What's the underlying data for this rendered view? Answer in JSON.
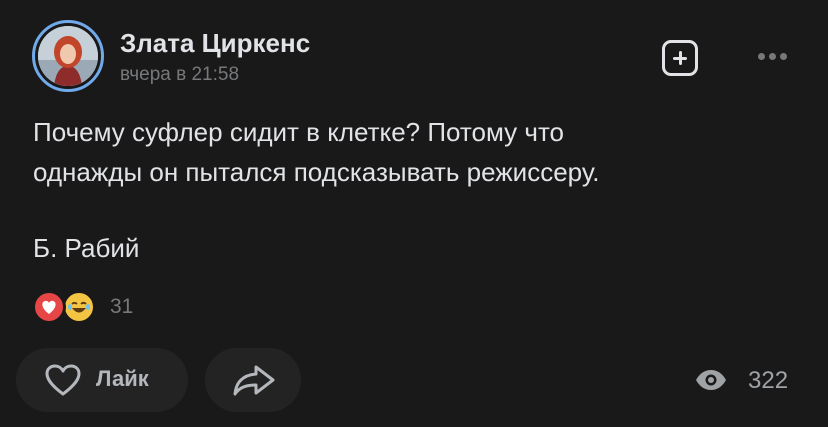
{
  "post": {
    "author": "Злата Циркенс",
    "time": "вчера в 21:58",
    "text_line1": "Почему суфлер сидит в клетке? Потому что",
    "text_line2": "однажды он пытался подсказывать режиссеру.",
    "signature": "Б. Рабий",
    "reactions_count": "31",
    "views_count": "322"
  },
  "actions": {
    "like_label": "Лайк"
  },
  "colors": {
    "background": "#19191a",
    "button_bg": "#232324",
    "accent": "#71aaeb",
    "text_primary": "#e1e3e6",
    "text_secondary": "#76787a",
    "heart_reaction": "#e64646",
    "laugh_reaction": "#f4c443"
  },
  "icons": {
    "add": "plus-square-icon",
    "more": "more-horizontal-icon",
    "like": "heart-outline-icon",
    "share": "share-arrow-icon",
    "views": "eye-icon",
    "reaction_1": "heart-reaction-icon",
    "reaction_2": "laughing-emoji-icon"
  }
}
